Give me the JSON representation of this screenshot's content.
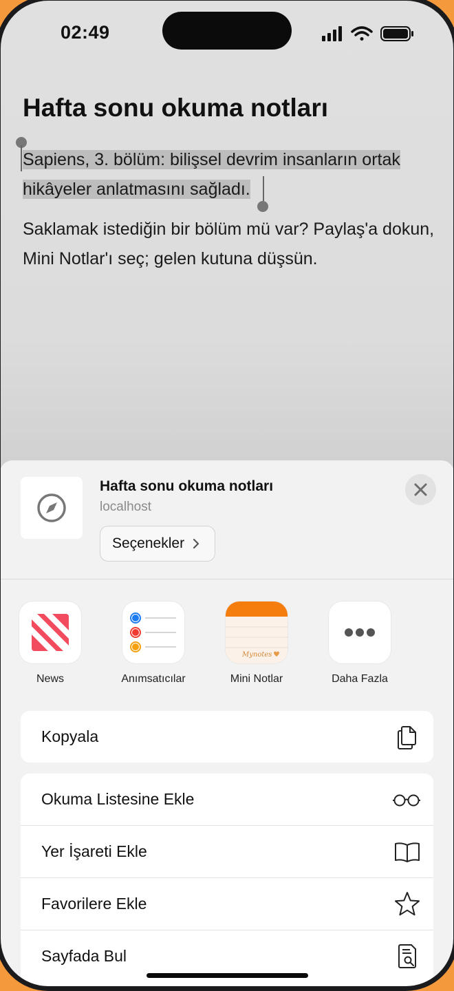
{
  "status_bar": {
    "time": "02:49"
  },
  "page": {
    "title": "Hafta sonu okuma notları",
    "selected_line1": "Sapiens, 3. bölüm: bilişsel devrim insanların ortak",
    "selected_line2": "hikâyeler anlatmasını sağladı.",
    "paragraph": "Saklamak istediğin bir bölüm mü var? Paylaş'a dokun, Mini Notlar'ı seç; gelen kutuna düşsün."
  },
  "share_sheet": {
    "title": "Hafta sonu okuma notları",
    "subtitle": "localhost",
    "options_label": "Seçenekler",
    "apps": [
      {
        "label": "News",
        "icon": "news-icon"
      },
      {
        "label": "Anımsatıcılar",
        "icon": "reminders-icon"
      },
      {
        "label": "Mini Notlar",
        "icon": "mini-notes-icon",
        "icon_text": "Mynotes"
      },
      {
        "label": "Daha Fazla",
        "icon": "more-icon"
      }
    ],
    "actions_group1": [
      {
        "label": "Kopyala",
        "icon": "copy-icon"
      }
    ],
    "actions_group2": [
      {
        "label": "Okuma Listesine Ekle",
        "icon": "glasses-icon"
      },
      {
        "label": "Yer İşareti Ekle",
        "icon": "book-icon"
      },
      {
        "label": "Favorilere Ekle",
        "icon": "star-icon"
      },
      {
        "label": "Sayfada Bul",
        "icon": "find-in-page-icon"
      }
    ]
  },
  "colors": {
    "wallpaper": "#f59a3c",
    "selection": "#bdbdbd",
    "notes_orange": "#f47d0e"
  }
}
